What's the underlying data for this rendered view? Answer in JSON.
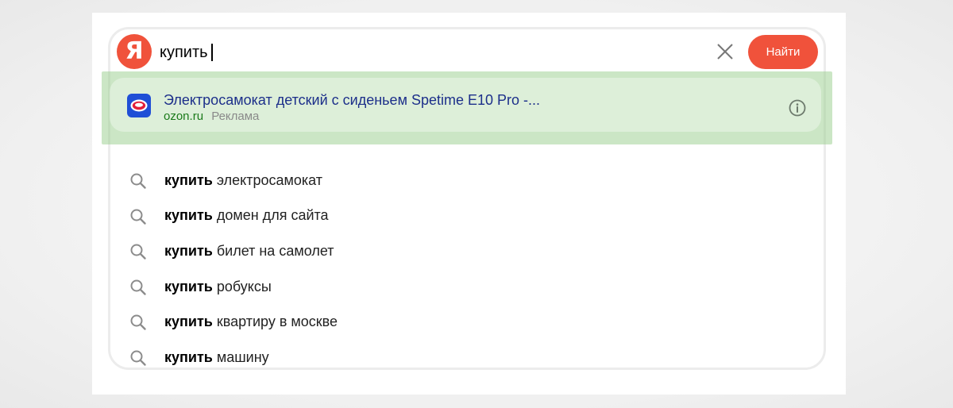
{
  "search": {
    "logo_letter": "Я",
    "query": "купить",
    "find_label": "Найти"
  },
  "ad": {
    "title": "Электросамокат детский с сиденьем Spetime E10 Pro -...",
    "domain": "ozon.ru",
    "label": "Реклама"
  },
  "suggestions": [
    {
      "bold": "купить",
      "rest": " электросамокат"
    },
    {
      "bold": "купить",
      "rest": " домен для сайта"
    },
    {
      "bold": "купить",
      "rest": " билет на самолет"
    },
    {
      "bold": "купить",
      "rest": " робуксы"
    },
    {
      "bold": "купить",
      "rest": " квартиру в москве"
    },
    {
      "bold": "купить",
      "rest": " машину"
    }
  ],
  "colors": {
    "brand": "#f0523b",
    "ad_title": "#1c2f8a",
    "ad_domain": "#1a7a1a",
    "highlight": "#a0d296"
  },
  "icons": {
    "logo": "yandex-logo-icon",
    "clear": "close-icon",
    "info": "info-icon",
    "suggest": "search-icon",
    "favicon": "ozon-favicon-icon"
  }
}
